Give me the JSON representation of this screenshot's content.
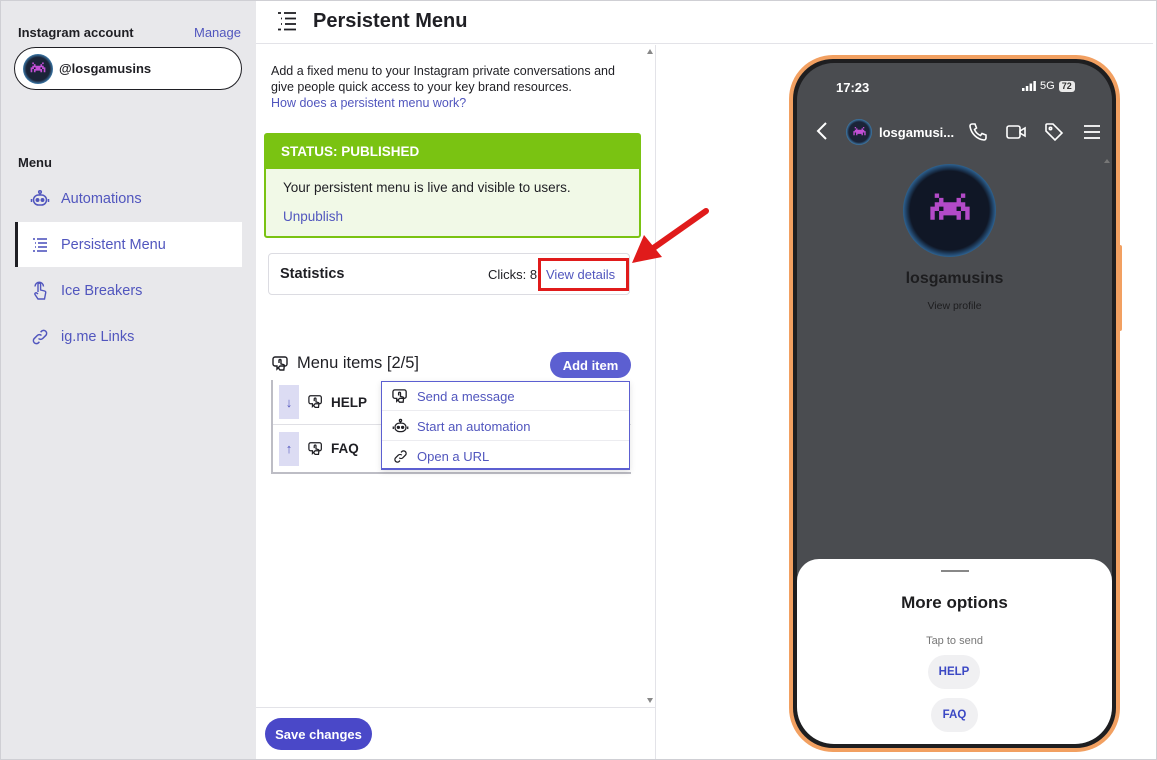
{
  "sidebar": {
    "account_label": "Instagram account",
    "manage_label": "Manage",
    "account_name": "@losgamusins",
    "menu_heading": "Menu",
    "items": [
      {
        "label": "Automations",
        "icon": "robot-icon"
      },
      {
        "label": "Persistent Menu",
        "icon": "list-icon",
        "active": true
      },
      {
        "label": "Ice Breakers",
        "icon": "tap-hand-icon"
      },
      {
        "label": "ig.me Links",
        "icon": "link-icon"
      }
    ]
  },
  "header": {
    "title": "Persistent Menu",
    "icon": "list-icon"
  },
  "main": {
    "intro": "Add a fixed menu to your Instagram private conversations and give people quick access to your key brand resources.",
    "intro_link": "How does a persistent menu work?",
    "status": {
      "heading": "STATUS: PUBLISHED",
      "text": "Your persistent menu is live and visible to users.",
      "unpublish": "Unpublish"
    },
    "statistics": {
      "title": "Statistics",
      "clicks": "Clicks: 8",
      "view_details": "View details"
    },
    "menu_items_title": "Menu items [2/5]",
    "add_item": "Add item",
    "items": [
      {
        "label": "HELP",
        "arrow": "↓"
      },
      {
        "label": "FAQ",
        "arrow": "↑"
      }
    ],
    "dropdown": [
      {
        "label": "Send a message",
        "icon": "message-icon"
      },
      {
        "label": "Start an automation",
        "icon": "robot-icon"
      },
      {
        "label": "Open a URL",
        "icon": "link-icon"
      }
    ],
    "save": "Save changes"
  },
  "phone": {
    "time": "17:23",
    "network": "5G",
    "battery": "72",
    "chat_name": "losgamusi...",
    "profile_name": "losgamusins",
    "view_profile": "View profile",
    "sheet_title": "More options",
    "sheet_sub": "Tap to send",
    "quick_replies": [
      "HELP",
      "FAQ"
    ]
  },
  "colors": {
    "accent": "#5156be",
    "published_green": "#7ac312",
    "phone_frame": "#f2a061",
    "highlight_red": "#e01b1b"
  }
}
